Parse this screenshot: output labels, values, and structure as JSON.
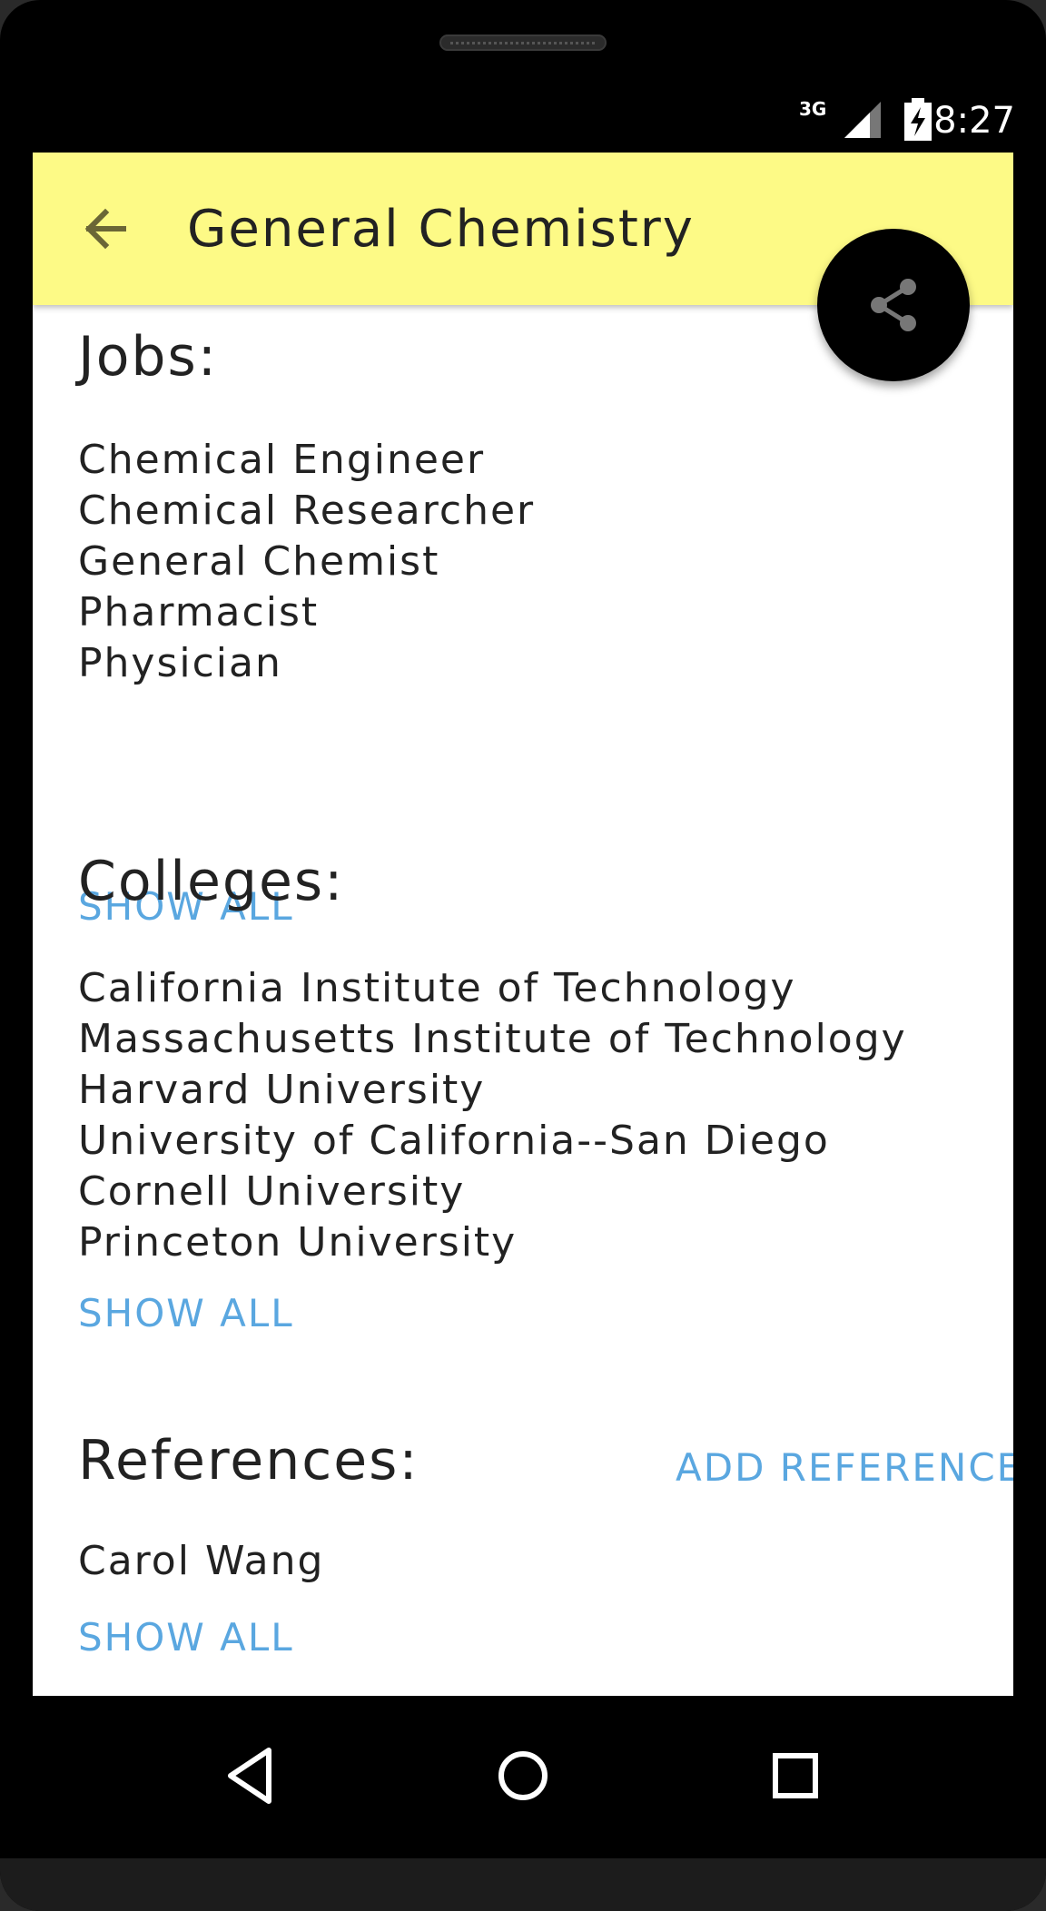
{
  "status_bar": {
    "network": "3G",
    "time": "8:27"
  },
  "app_bar": {
    "title": "General Chemistry",
    "back_icon": "arrow-back-icon",
    "share_icon": "share-icon",
    "background_color": "#fdfa86"
  },
  "sections": {
    "jobs": {
      "heading": "Jobs:",
      "items": [
        "Chemical Engineer",
        "Chemical Researcher",
        "General Chemist",
        "Pharmacist",
        "Physician"
      ],
      "show_all": "SHOW ALL"
    },
    "colleges": {
      "heading": "Colleges:",
      "items": [
        "California Institute of Technology",
        "Massachusetts Institute of Technology",
        "Harvard University",
        "University of California--San Diego",
        "Cornell University",
        "Princeton University"
      ],
      "show_all": "SHOW ALL"
    },
    "references": {
      "heading": "References:",
      "add_label": "ADD REFERENCE",
      "items": [
        "Carol Wang"
      ],
      "show_all": "SHOW ALL"
    }
  },
  "nav_bar": {
    "back_icon": "nav-back-icon",
    "home_icon": "nav-home-icon",
    "recents_icon": "nav-recents-icon"
  },
  "colors": {
    "link": "#5aa7e0",
    "text": "#222222"
  }
}
